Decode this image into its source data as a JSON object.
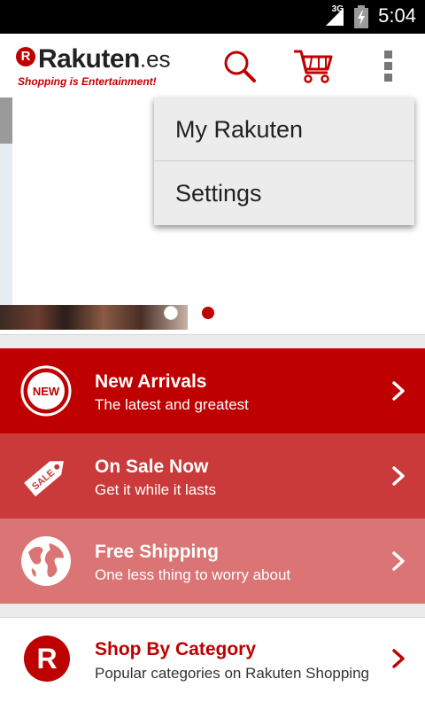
{
  "status_bar": {
    "network": "3G",
    "time": "5:04"
  },
  "app_bar": {
    "logo_mark": "R",
    "logo_name": "Rakuten",
    "logo_tld": ".es",
    "tagline": "Shopping is Entertainment!",
    "icons": [
      "search-icon",
      "cart-icon",
      "overflow-menu-icon"
    ]
  },
  "overflow_menu": {
    "items": [
      {
        "label": "My Rakuten"
      },
      {
        "label": "Settings"
      }
    ]
  },
  "carousel": {
    "slide_count": 2,
    "active_index": 1
  },
  "promos": [
    {
      "title": "New Arrivals",
      "subtitle": "The latest and greatest",
      "icon_text": "NEW",
      "icon": "new-badge-icon",
      "color": "#bf0000"
    },
    {
      "title": "On Sale Now",
      "subtitle": "Get it while it lasts",
      "icon_text": "SALE",
      "icon": "sale-tag-icon",
      "color": "#ca3a3a"
    },
    {
      "title": "Free Shipping",
      "subtitle": "One less thing to worry about",
      "icon": "globe-icon",
      "color": "#db7474"
    }
  ],
  "shop_by_category": {
    "logo_mark": "R",
    "title": "Shop By Category",
    "subtitle": "Popular categories on Rakuten Shopping"
  },
  "colors": {
    "brand_red": "#bf0000",
    "promo_mid": "#ca3a3a",
    "promo_light": "#db7474",
    "menu_bg": "#ececec"
  }
}
